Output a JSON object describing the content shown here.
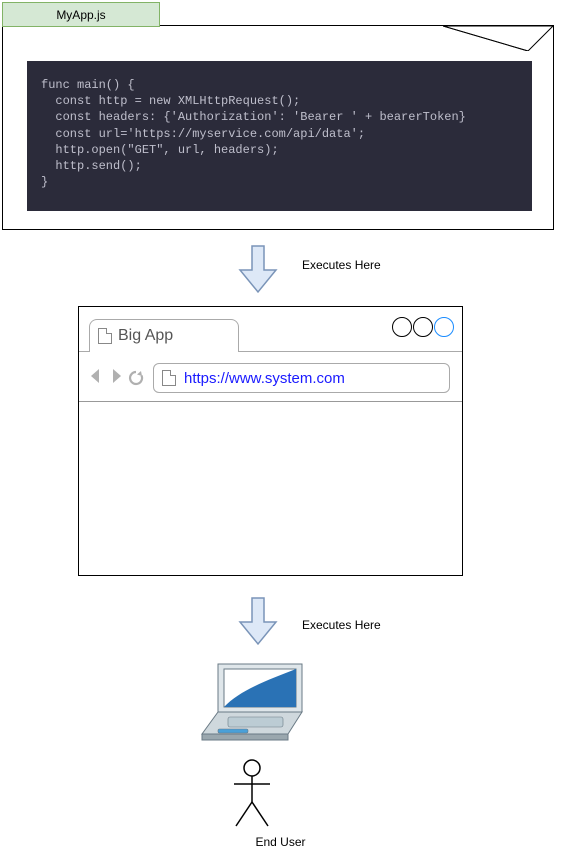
{
  "file": {
    "tab_label": "MyApp.js",
    "code": "func main() {\n  const http = new XMLHttpRequest();\n  const headers: {'Authorization': 'Bearer ' + bearerToken}\n  const url='https://myservice.com/api/data';\n  http.open(\"GET\", url, headers);\n  http.send();\n}"
  },
  "arrow1_label": "Executes  Here",
  "browser": {
    "tab_title": "Big App",
    "url": "https://www.system.com"
  },
  "arrow2_label": "Executes  Here",
  "end_user_label": "End User"
}
